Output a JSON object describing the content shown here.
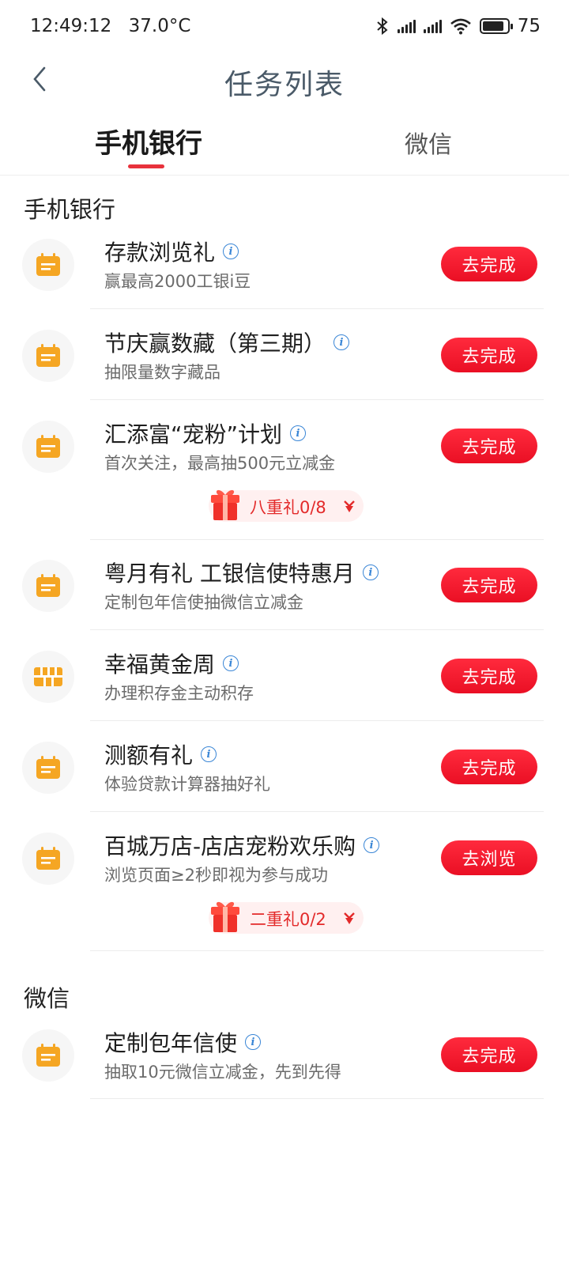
{
  "status_bar": {
    "time": "12:49:12",
    "temperature": "37.0°C",
    "battery": "75"
  },
  "nav": {
    "title": "任务列表"
  },
  "tabs": [
    {
      "label": "手机银行",
      "active": true
    },
    {
      "label": "微信",
      "active": false
    }
  ],
  "sections": [
    {
      "title": "手机银行",
      "tasks": [
        {
          "title": "存款浏览礼",
          "subtitle": "赢最高2000工银i豆",
          "button": "去完成",
          "icon": "calendar-icon"
        },
        {
          "title": "节庆赢数藏（第三期）",
          "subtitle": "抽限量数字藏品",
          "button": "去完成",
          "icon": "calendar-icon"
        },
        {
          "title": "汇添富“宠粉”计划",
          "subtitle": "首次关注，最高抽500元立减金",
          "button": "去完成",
          "icon": "calendar-icon",
          "gift": "八重礼0/8"
        },
        {
          "title": "粤月有礼 工银信使特惠月",
          "subtitle": "定制包年信使抽微信立减金",
          "button": "去完成",
          "icon": "calendar-icon"
        },
        {
          "title": "幸福黄金周",
          "subtitle": "办理积存金主动积存",
          "button": "去完成",
          "icon": "gold-bar-icon"
        },
        {
          "title": "测额有礼",
          "subtitle": "体验贷款计算器抽好礼",
          "button": "去完成",
          "icon": "calendar-icon"
        },
        {
          "title": "百城万店-店店宠粉欢乐购",
          "subtitle": "浏览页面≥2秒即视为参与成功",
          "button": "去浏览",
          "icon": "calendar-icon",
          "gift": "二重礼0/2"
        }
      ]
    },
    {
      "title": "微信",
      "tasks": [
        {
          "title": "定制包年信使",
          "subtitle": "抽取10元微信立减金，先到先得",
          "button": "去完成",
          "icon": "calendar-icon"
        }
      ]
    }
  ],
  "colors": {
    "accent": "#e8323c",
    "icon_orange": "#f5a623",
    "info_blue": "#3a86d6"
  }
}
